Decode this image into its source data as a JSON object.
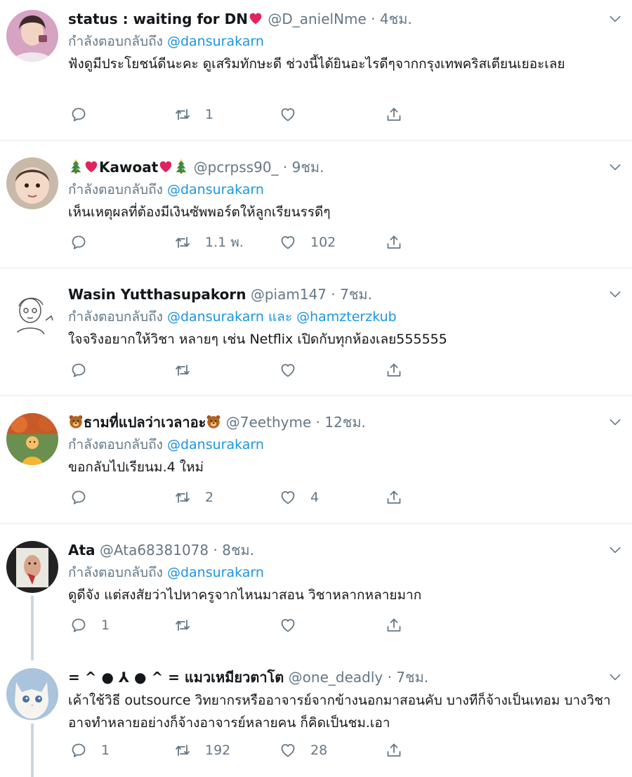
{
  "reply_prefix": "กำลังตอบกลับถึง",
  "tweets": [
    {
      "name": "status : waiting for DN",
      "handle": "@D_anielNme",
      "time": "· 4ชม.",
      "mention": "@dansurakarn",
      "text": "ฟังดูมีประโยชน์ดีนะคะ ดูเสริมทักษะดี ช่วงนี้ได้ยินอะไรดีๆจากกรุงเทพคริสเตียนเยอะเลย",
      "reply_count": "",
      "retweet_count": "1",
      "like_count": ""
    },
    {
      "name": "Kawoat",
      "handle": "@pcrpss90_",
      "time": "· 9ชม.",
      "mention": "@dansurakarn",
      "text": "เห็นเหตุผลที่ต้องมีเงินซัพพอร์ตให้ลูกเรียนรรดีๆ",
      "reply_count": "",
      "retweet_count": "1.1 พ.",
      "like_count": "102"
    },
    {
      "name": "Wasin Yutthasupakorn",
      "handle": "@piam147",
      "time": "· 7ชม.",
      "mention": "@dansurakarn และ @hamzterzkub",
      "text": "ใจจริงอยากให้วิชา หลายๆ เช่น Netflix เปิดกับทุกห้องเลย555555",
      "reply_count": "",
      "retweet_count": "",
      "like_count": ""
    },
    {
      "name": "ธามที่แปลว่าเวลาอะ",
      "handle": "@7eethyme",
      "time": "· 12ชม.",
      "mention": "@dansurakarn",
      "text": "ขอกลับไปเรียนม.4 ใหม่",
      "reply_count": "",
      "retweet_count": "2",
      "like_count": "4"
    },
    {
      "name": "Ata",
      "handle": "@Ata68381078",
      "time": "· 8ชม.",
      "mention": "@dansurakarn",
      "text": "ดูดีจัง แต่สงสัยว่าไปหาครูจากไหนมาสอน วิชาหลากหลายมาก",
      "reply_count": "1",
      "retweet_count": "",
      "like_count": ""
    },
    {
      "name": "= ^ ● ⅄ ● ^ = แมวเหมียวตาโต",
      "handle": "@one_deadly",
      "time": "· 7ชม.",
      "mention": "",
      "text": "เค้าใช้วิธี outsource วิทยากรหรืออาจารย์จากข้างนอกมาสอนคับ บางทีก็จ้างเป็นเทอม บางวิชาอาจทำหลายอย่างก็จ้างอาจารย์หลายคน ก็คิดเป็นชม.เอา",
      "reply_count": "1",
      "retweet_count": "192",
      "like_count": "28"
    }
  ],
  "colors": {
    "link": "#1b95e0",
    "muted": "#657786",
    "heart": "#e0245e",
    "divider": "#e6ecf0"
  },
  "icons": [
    "reply-icon",
    "retweet-icon",
    "like-icon",
    "share-icon",
    "chevron-down-icon",
    "heart-emoji",
    "tree-emoji",
    "bear-emoji"
  ]
}
